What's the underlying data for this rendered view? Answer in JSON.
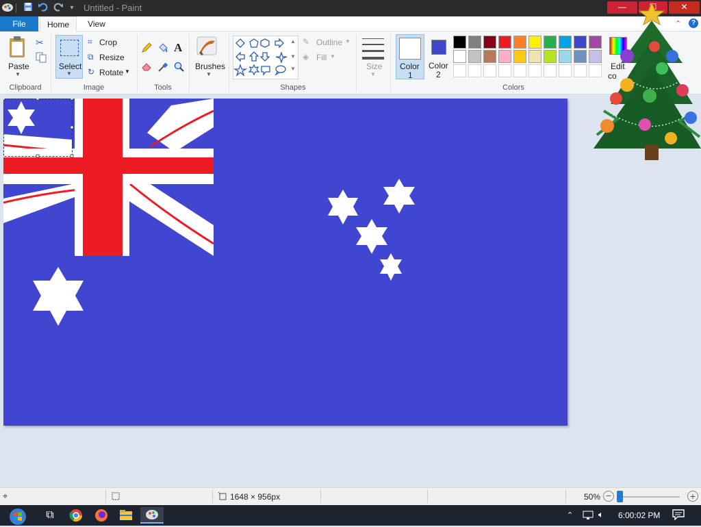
{
  "window": {
    "title": "Untitled - Paint"
  },
  "menu": {
    "file": "File",
    "home": "Home",
    "view": "View"
  },
  "clipboard": {
    "paste": "Paste",
    "group": "Clipboard"
  },
  "image": {
    "select": "Select",
    "crop": "Crop",
    "resize": "Resize",
    "rotate": "Rotate",
    "group": "Image"
  },
  "tools": {
    "group": "Tools"
  },
  "brushes": {
    "label": "Brushes"
  },
  "shapes": {
    "outline": "Outline",
    "fill": "Fill",
    "group": "Shapes"
  },
  "size": {
    "label": "Size"
  },
  "colors": {
    "color1_label": "Color",
    "color1_num": "1",
    "color2_label": "Color",
    "color2_num": "2",
    "edit_label": "Edit",
    "edit_label2": "co",
    "group": "Colors",
    "color1": "#ffffff",
    "color2": "#3f48cc",
    "palette_row1": [
      "#000000",
      "#7f7f7f",
      "#880015",
      "#ed1c24",
      "#ff7f27",
      "#fff200",
      "#22b14c",
      "#00a2e8",
      "#3f48cc",
      "#a349a4"
    ],
    "palette_row2": [
      "#ffffff",
      "#c3c3c3",
      "#b97a57",
      "#ffaec9",
      "#ffc90e",
      "#efe4b0",
      "#b5e61d",
      "#99d9ea",
      "#7092be",
      "#c8bfe7"
    ]
  },
  "canvas": {
    "background": "#4146d0"
  },
  "status": {
    "dimensions": "1648 × 956px",
    "zoom": "50%",
    "zoom_level": 0.5
  },
  "taskbar": {
    "time": "6:00:02 PM"
  }
}
